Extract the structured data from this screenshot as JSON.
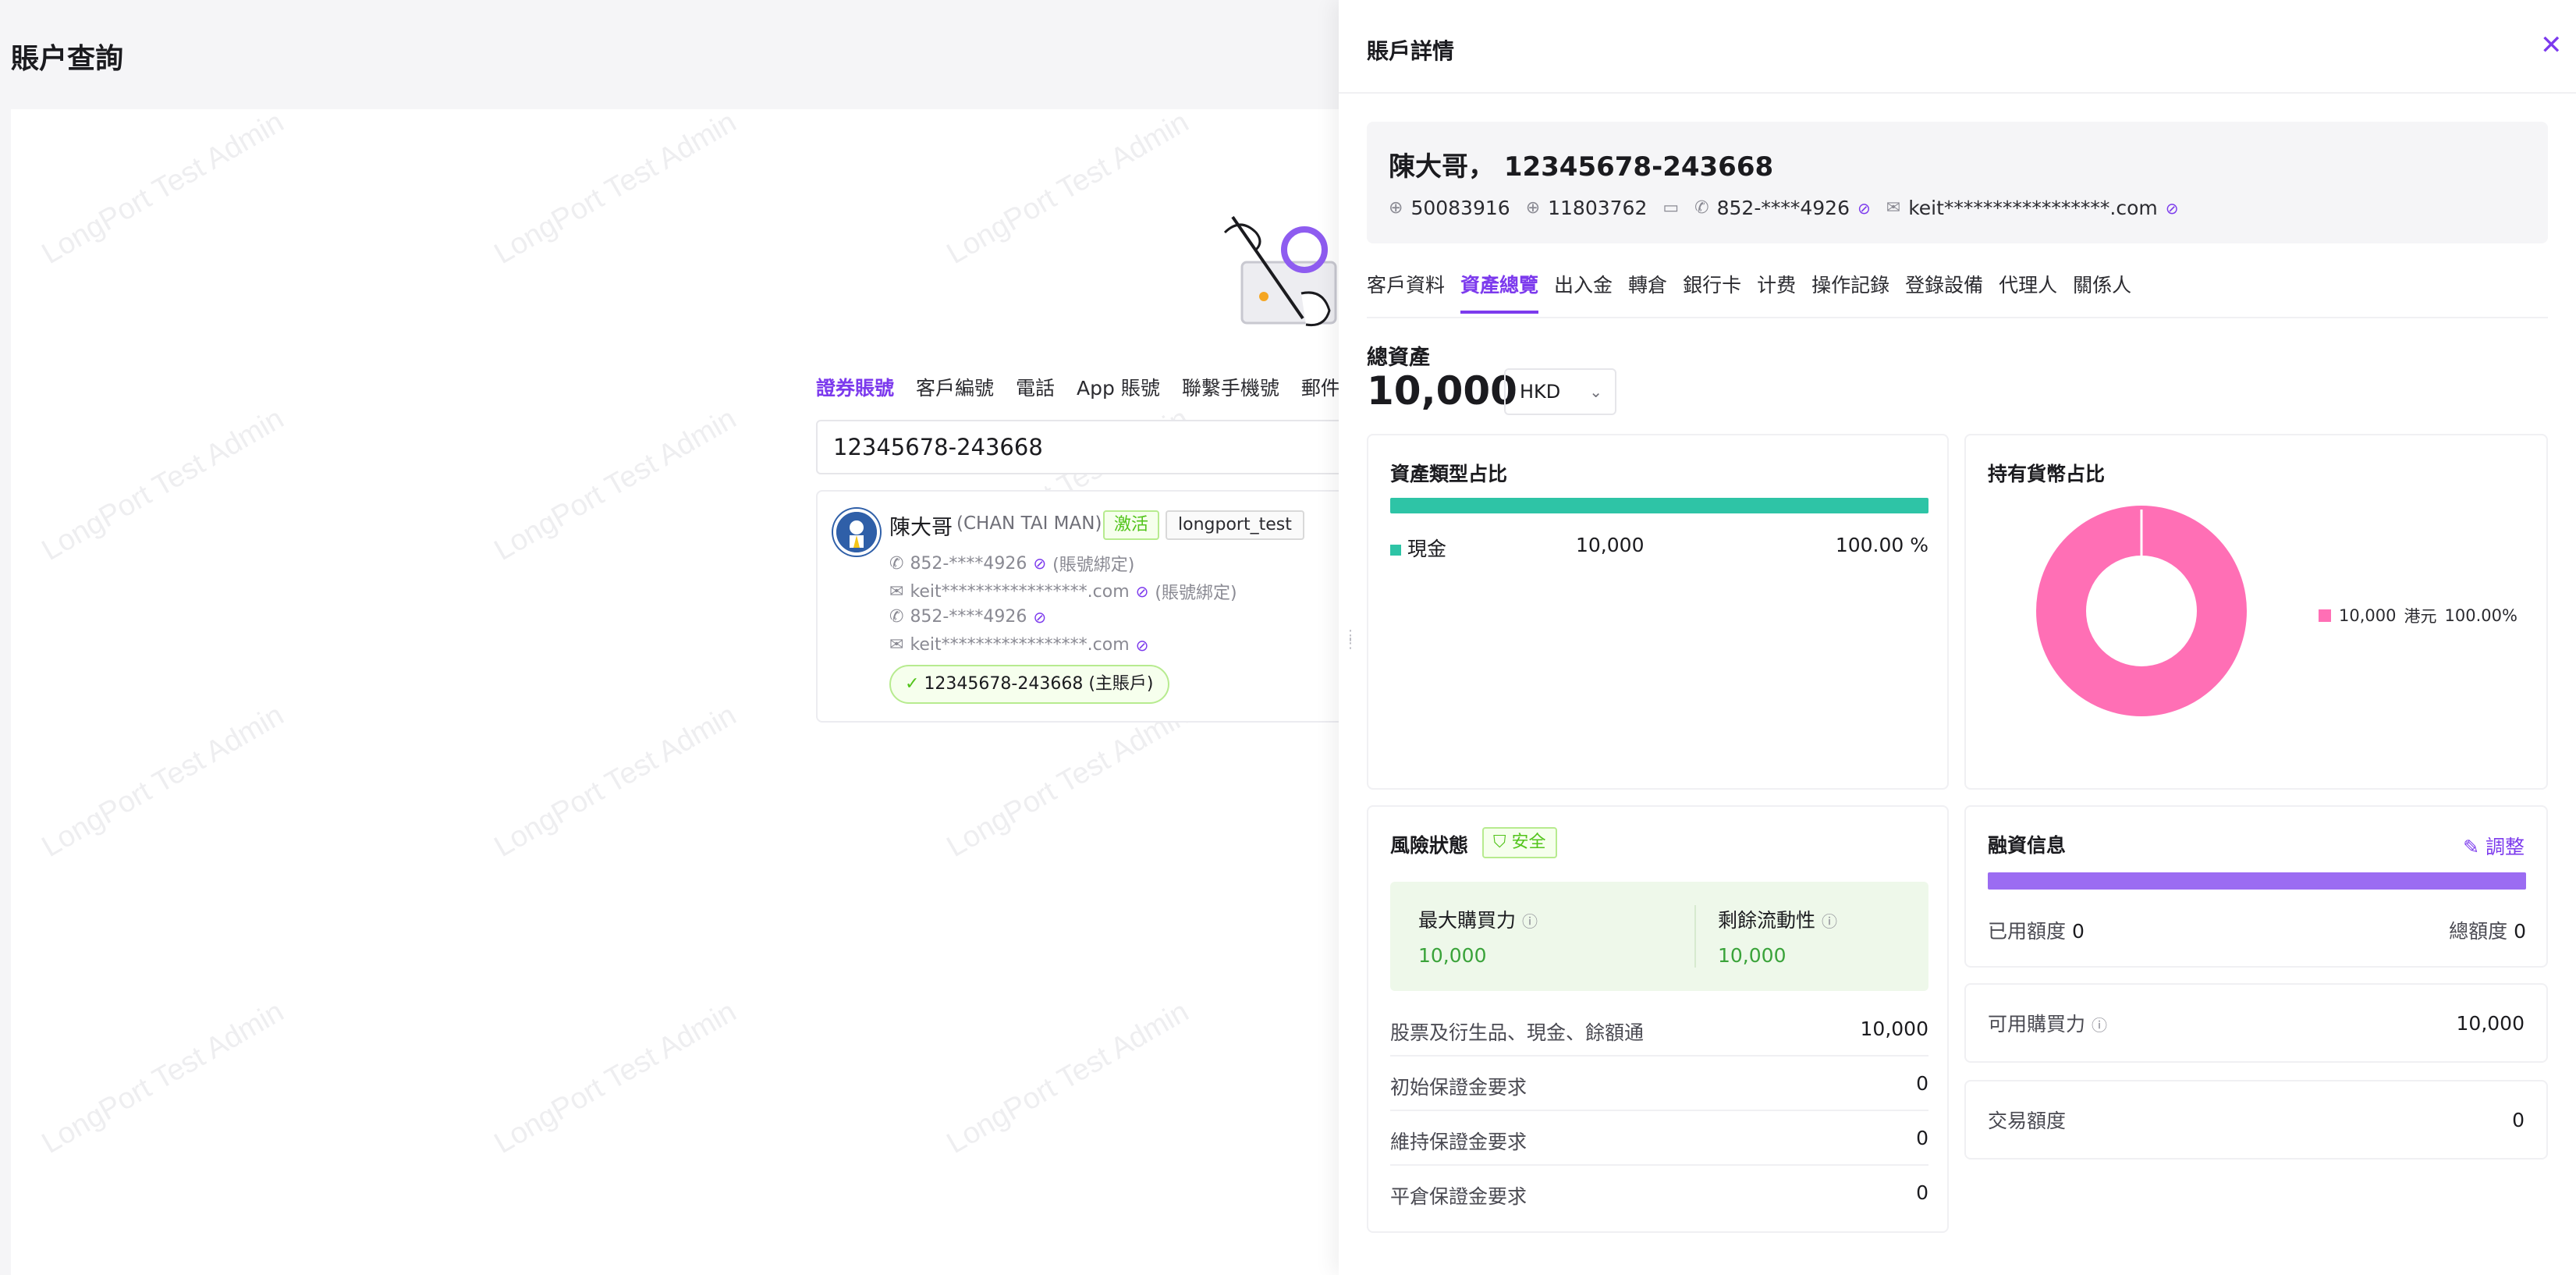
{
  "page": {
    "title": "賬户查詢",
    "watermark": "LongPort Test Admin"
  },
  "search": {
    "tabs": [
      "證券賬號",
      "客戶編號",
      "電話",
      "App 賬號",
      "聯繫手機號",
      "郵件"
    ],
    "active_tab": 0,
    "input_value": "12345678-243668"
  },
  "result": {
    "name": "陳大哥",
    "name_en": "(CHAN TAI MAN)",
    "status_tag": "激活",
    "env_tag": "longport_test",
    "lines": [
      {
        "icon": "phone-icon",
        "text": "852-****4926",
        "suffix": "(賬號綁定)"
      },
      {
        "icon": "mail-icon",
        "text": "keit*****************.com",
        "suffix": "(賬號綁定)"
      },
      {
        "icon": "phone-icon",
        "text": "852-****4926",
        "suffix": ""
      },
      {
        "icon": "mail-icon",
        "text": "keit*****************.com",
        "suffix": ""
      }
    ],
    "main_account": "12345678-243668 (主賬戶)"
  },
  "drawer": {
    "title": "賬戶詳情",
    "profile": {
      "name_line": "陳大哥， 12345678-243668",
      "id1": "50083916",
      "id2": "11803762",
      "phone": "852-****4926",
      "email": "keit*****************.com"
    },
    "tabs": [
      "客戶資料",
      "資產總覽",
      "出入金",
      "轉倉",
      "銀行卡",
      "计费",
      "操作記錄",
      "登錄設備",
      "代理人",
      "關係人"
    ],
    "active_tab": 1,
    "total": {
      "label": "總資產",
      "value": "10,000",
      "currency": "HKD"
    },
    "asset_type": {
      "title": "資產類型占比",
      "row": {
        "name": "現金",
        "value": "10,000",
        "percent": "100.00 %"
      },
      "color": "#2ec4a6"
    },
    "currency_share": {
      "title": "持有貨幣占比",
      "legend": {
        "value": "10,000",
        "currency": "港元",
        "percent": "100.00%"
      },
      "color": "#ff6fb5"
    },
    "risk": {
      "title": "風險狀態",
      "badge": "安全",
      "max_buying_power": {
        "label": "最大購買力",
        "value": "10,000"
      },
      "excess_liquidity": {
        "label": "剩餘流動性",
        "value": "10,000"
      },
      "lines": [
        {
          "label": "股票及衍生品、現金、餘額通",
          "value": "10,000"
        },
        {
          "label": "初始保證金要求",
          "value": "0"
        },
        {
          "label": "維持保證金要求",
          "value": "0"
        },
        {
          "label": "平倉保證金要求",
          "value": "0"
        }
      ]
    },
    "financing": {
      "title": "融資信息",
      "adjust_label": "調整",
      "used_label": "已用額度",
      "used_value": "0",
      "total_label": "總額度",
      "total_value": "0",
      "bar_color": "#9b6cf2"
    },
    "available_buying_power": {
      "label": "可用購買力",
      "value": "10,000"
    },
    "trading_limit": {
      "label": "交易額度",
      "value": "0"
    }
  },
  "colors": {
    "accent": "#7c3aed",
    "success": "#52c41a"
  }
}
